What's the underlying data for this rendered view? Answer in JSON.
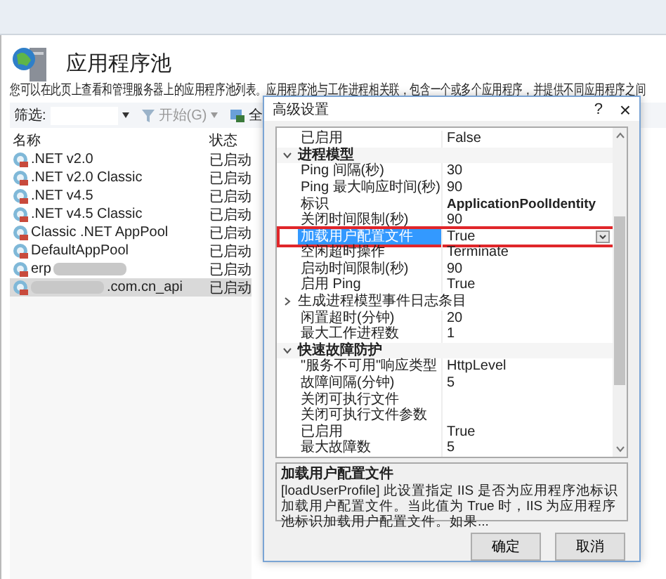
{
  "page": {
    "title": "应用程序池",
    "description": "您可以在此页上查看和管理服务器上的应用程序池列表。应用程序池与工作进程相关联，包含一个或多个应用程序，并提供不同应用程序之间"
  },
  "filter": {
    "label": "筛选:",
    "go": "开始(G)",
    "show_all": "全"
  },
  "pool_list": {
    "columns": [
      "名称",
      "状态"
    ],
    "rows": [
      {
        "kind": "plain",
        "name": ".NET v2.0",
        "status": "已启动",
        "selected": false
      },
      {
        "kind": "plain",
        "name": ".NET v2.0 Classic",
        "status": "已启动",
        "selected": false
      },
      {
        "kind": "plain",
        "name": ".NET v4.5",
        "status": "已启动",
        "selected": false
      },
      {
        "kind": "plain",
        "name": ".NET v4.5 Classic",
        "status": "已启动",
        "selected": false
      },
      {
        "kind": "plain",
        "name": "Classic .NET AppPool",
        "status": "已启动",
        "selected": false
      },
      {
        "kind": "plain",
        "name": "DefaultAppPool",
        "status": "已启动",
        "selected": false
      },
      {
        "kind": "tailmasked",
        "name": "erp",
        "status": "已启动",
        "selected": false
      },
      {
        "kind": "headmasked",
        "name": ".com.cn_api",
        "status": "已启动",
        "selected": true
      }
    ]
  },
  "dialog": {
    "title": "高级设置",
    "help": "?",
    "close": "×",
    "properties": [
      {
        "kind": "property",
        "name": "已启用",
        "value": "False",
        "selected": false
      },
      {
        "kind": "category",
        "name": "进程模型",
        "expanded": true
      },
      {
        "kind": "property",
        "name": "Ping 间隔(秒)",
        "value": "30",
        "selected": false
      },
      {
        "kind": "property",
        "name": "Ping 最大响应时间(秒)",
        "value": "90",
        "selected": false
      },
      {
        "kind": "custom",
        "name": "标识",
        "value": "ApplicationPoolIdentity",
        "selected": false
      },
      {
        "kind": "property",
        "name": "关闭时间限制(秒)",
        "value": "90",
        "selected": false
      },
      {
        "kind": "property",
        "name": "加载用户配置文件",
        "value": "True",
        "selected": true
      },
      {
        "kind": "property",
        "name": "空闲超时操作",
        "value": "Terminate",
        "selected": false
      },
      {
        "kind": "property",
        "name": "启动时间限制(秒)",
        "value": "90",
        "selected": false
      },
      {
        "kind": "property",
        "name": "启用 Ping",
        "value": "True",
        "selected": false
      },
      {
        "kind": "group",
        "name": "生成进程模型事件日志条目",
        "expanded": false
      },
      {
        "kind": "property",
        "name": "闲置超时(分钟)",
        "value": "20",
        "selected": false
      },
      {
        "kind": "property",
        "name": "最大工作进程数",
        "value": "1",
        "selected": false
      },
      {
        "kind": "category",
        "name": "快速故障防护",
        "expanded": true
      },
      {
        "kind": "property",
        "name": "\"服务不可用\"响应类型",
        "value": "HttpLevel",
        "selected": false
      },
      {
        "kind": "property",
        "name": "故障间隔(分钟)",
        "value": "5",
        "selected": false
      },
      {
        "kind": "property",
        "name": "关闭可执行文件",
        "selected": false
      },
      {
        "kind": "property",
        "name": "关闭可执行文件参数",
        "selected": false
      },
      {
        "kind": "property",
        "name": "已启用",
        "value": "True",
        "selected": false
      },
      {
        "kind": "property",
        "name": "最大故障数",
        "value": "5",
        "selected": false
      }
    ],
    "description_title": "加载用户配置文件",
    "description": "[loadUserProfile] 此设置指定 IIS 是否为应用程序池标识加载用户配置文件。当此值为 True 时，IIS 为应用程序池标识加载用户配置文件。如果...",
    "buttons": [
      "确定",
      "取消"
    ]
  }
}
